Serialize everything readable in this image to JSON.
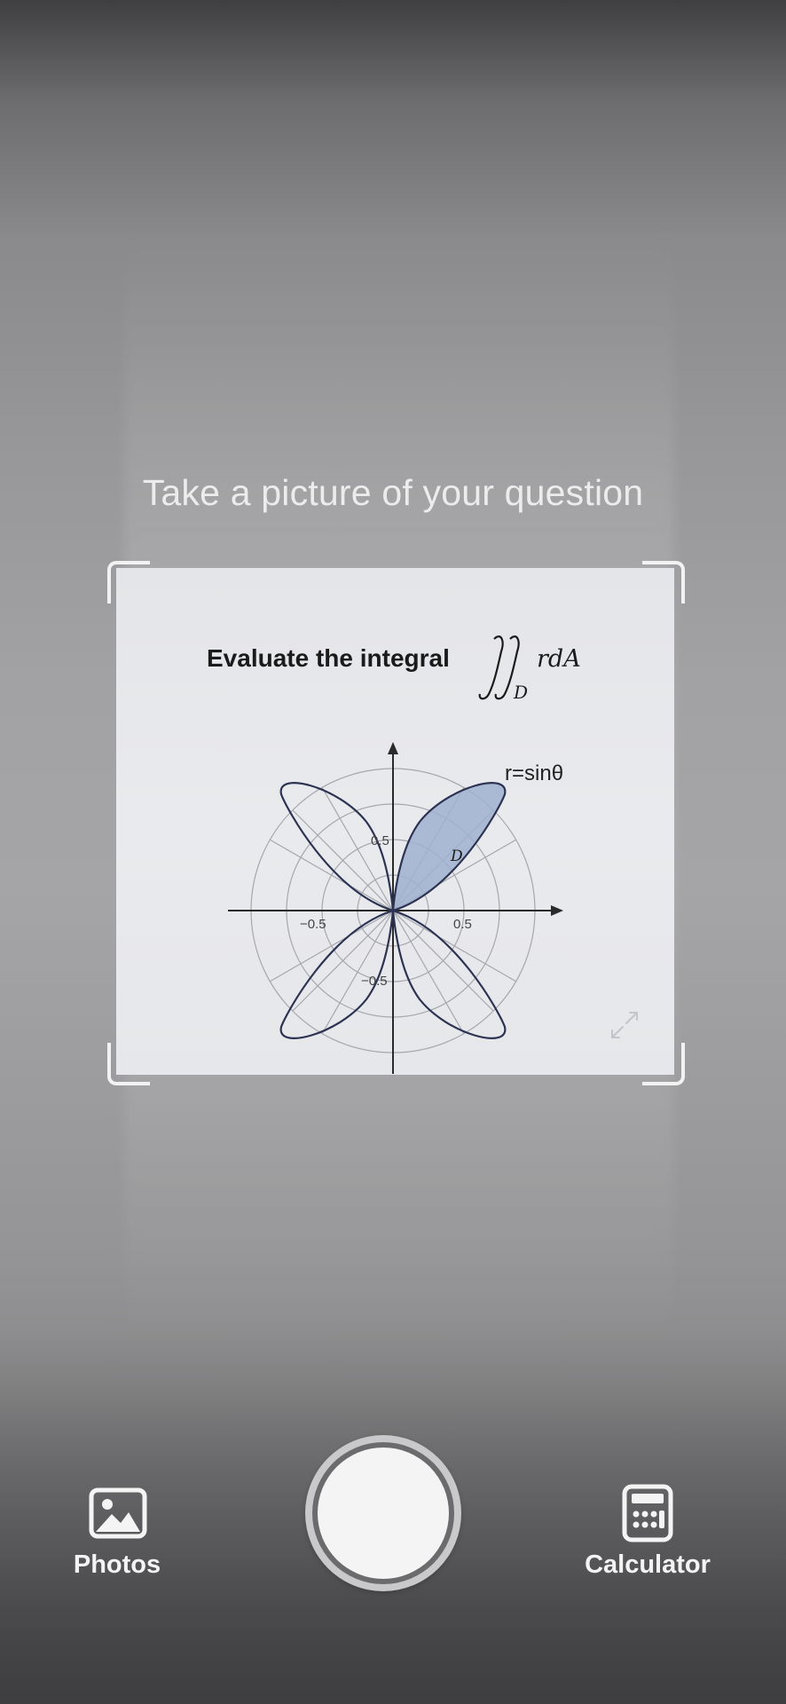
{
  "camera": {
    "prompt": "Take a picture of your question"
  },
  "captured_question": {
    "text": "Evaluate the integral",
    "integral_integrand": "rdA",
    "integral_region": "D",
    "curve_label": "r=sinθ",
    "region_label": "D",
    "plot_ticks": {
      "y_pos": "0.5",
      "y_neg": "−0.5",
      "x_pos": "0.5",
      "x_neg": "−0.5"
    },
    "shaded_color": "#9fb0cf"
  },
  "controls": {
    "photos_label": "Photos",
    "photos_icon": "image-icon",
    "calculator_label": "Calculator",
    "calculator_icon": "calculator-icon",
    "shutter_icon": "shutter-button"
  }
}
